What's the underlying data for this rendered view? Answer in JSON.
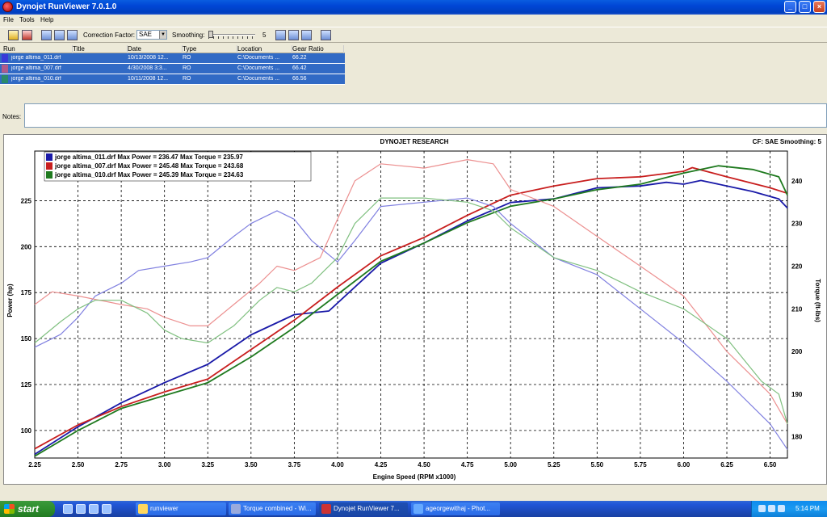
{
  "window": {
    "title": "Dynojet RunViewer 7.0.1.0",
    "min": "_",
    "max": "□",
    "close": "×"
  },
  "menu": [
    "File",
    "Tools",
    "Help"
  ],
  "toolbar": {
    "correction_label": "Correction Factor:",
    "correction_value": "SAE",
    "smoothing_label": "Smoothing:",
    "smoothing_value": "5"
  },
  "runs": {
    "headers": [
      "Run",
      "Title",
      "Date",
      "Type",
      "Location",
      "Gear Ratio"
    ],
    "rows": [
      {
        "run": "jorge altima_011.drf",
        "title": "",
        "date": "10/13/2008 12...",
        "type": "RO",
        "location": "C:\\Documents ...",
        "gear": "66.22",
        "color": "#3a3ad8"
      },
      {
        "run": "jorge altima_007.drf",
        "title": "",
        "date": "4/30/2008 3:3...",
        "type": "RO",
        "location": "C:\\Documents ...",
        "gear": "66.42",
        "color": "#d83a3a"
      },
      {
        "run": "jorge altima_010.drf",
        "title": "",
        "date": "10/11/2008 12...",
        "type": "RO",
        "location": "C:\\Documents ...",
        "gear": "66.56",
        "color": "#2a8a2a"
      }
    ]
  },
  "notes": {
    "label": "Notes:"
  },
  "chart_header": {
    "title": "DYNOJET RESEARCH",
    "settings": "CF: SAE  Smoothing: 5"
  },
  "chart_data": {
    "type": "line",
    "xlabel": "Engine Speed (RPM x1000)",
    "ylabel": "Power (hp)",
    "y2label": "Torque (ft-lbs)",
    "xlim": [
      2.25,
      6.6
    ],
    "ylim": [
      85,
      252
    ],
    "y2lim": [
      175,
      247
    ],
    "xticks": [
      "2.25",
      "2.50",
      "2.75",
      "3.00",
      "3.25",
      "3.50",
      "3.75",
      "4.00",
      "4.25",
      "4.50",
      "4.75",
      "5.00",
      "5.25",
      "5.50",
      "5.75",
      "6.00",
      "6.25",
      "6.50"
    ],
    "yticks": [
      "100",
      "125",
      "150",
      "175",
      "200",
      "225"
    ],
    "y2ticks": [
      "180",
      "190",
      "200",
      "210",
      "220",
      "230",
      "240"
    ],
    "grid": true,
    "legend_position": "top-left",
    "legend": [
      {
        "color": "#1a1aa8",
        "text": "jorge altima_011.drf Max Power = 236.47 Max Torque = 235.97"
      },
      {
        "color": "#c81e1e",
        "text": "jorge altima_007.drf Max Power = 245.48 Max Torque = 243.68"
      },
      {
        "color": "#1f7a1f",
        "text": "jorge altima_010.drf Max Power = 245.39 Max Torque = 234.63"
      }
    ],
    "series": [
      {
        "name": "jorge altima_011.drf",
        "kind": "power",
        "axis": "left",
        "color": "#1a1aa8",
        "x": [
          2.25,
          2.5,
          2.75,
          3.0,
          3.25,
          3.5,
          3.75,
          3.95,
          4.25,
          4.5,
          4.75,
          5.0,
          5.25,
          5.5,
          5.75,
          5.9,
          6.0,
          6.1,
          6.25,
          6.4,
          6.55,
          6.6
        ],
        "y": [
          87,
          102,
          115,
          126,
          136,
          152,
          163,
          165,
          191,
          202,
          214,
          224,
          226,
          232,
          233,
          235,
          234,
          236,
          233,
          230,
          226,
          221
        ]
      },
      {
        "name": "jorge altima_007.drf",
        "kind": "power",
        "axis": "left",
        "color": "#c81e1e",
        "x": [
          2.25,
          2.5,
          2.75,
          3.0,
          3.25,
          3.5,
          3.75,
          4.0,
          4.25,
          4.5,
          4.75,
          5.0,
          5.25,
          5.5,
          5.75,
          6.0,
          6.05,
          6.25,
          6.5,
          6.6
        ],
        "y": [
          90,
          103,
          113,
          121,
          128,
          144,
          160,
          178,
          195,
          205,
          217,
          228,
          233,
          237,
          238,
          241,
          243,
          238,
          232,
          229
        ]
      },
      {
        "name": "jorge altima_010.drf",
        "kind": "power",
        "axis": "left",
        "color": "#1f7a1f",
        "x": [
          2.25,
          2.5,
          2.75,
          3.0,
          3.25,
          3.5,
          3.75,
          4.0,
          4.25,
          4.5,
          4.75,
          5.0,
          5.25,
          5.5,
          5.75,
          6.0,
          6.2,
          6.4,
          6.55,
          6.6
        ],
        "y": [
          86,
          100,
          112,
          119,
          126,
          140,
          156,
          174,
          192,
          202,
          213,
          222,
          226,
          231,
          234,
          240,
          244,
          242,
          238,
          228
        ]
      },
      {
        "name": "jorge altima_011.drf",
        "kind": "torque",
        "axis": "right",
        "color": "#8080e0",
        "x": [
          2.25,
          2.4,
          2.5,
          2.6,
          2.75,
          2.85,
          3.0,
          3.15,
          3.25,
          3.4,
          3.5,
          3.6,
          3.65,
          3.75,
          3.85,
          4.0,
          4.1,
          4.25,
          4.5,
          4.75,
          4.9,
          5.0,
          5.25,
          5.5,
          5.75,
          6.0,
          6.25,
          6.5,
          6.6
        ],
        "y": [
          201,
          204,
          208,
          213,
          216,
          219,
          220,
          221,
          222,
          227,
          230,
          232,
          233,
          231,
          226,
          221,
          226,
          234,
          235,
          236,
          234,
          230,
          222,
          218,
          210,
          202,
          193,
          183,
          177
        ]
      },
      {
        "name": "jorge altima_007.drf",
        "kind": "torque",
        "axis": "right",
        "color": "#ec9090",
        "x": [
          2.25,
          2.35,
          2.5,
          2.75,
          2.9,
          3.0,
          3.15,
          3.25,
          3.4,
          3.55,
          3.65,
          3.75,
          3.9,
          4.0,
          4.1,
          4.25,
          4.5,
          4.75,
          4.9,
          5.0,
          5.25,
          5.5,
          5.75,
          6.0,
          6.25,
          6.5,
          6.6
        ],
        "y": [
          211,
          214,
          213,
          211,
          210,
          208,
          206,
          206,
          211,
          216,
          220,
          219,
          222,
          231,
          240,
          244,
          243,
          245,
          244,
          238,
          234,
          227,
          220,
          213,
          200,
          190,
          183
        ]
      },
      {
        "name": "jorge altima_010.drf",
        "kind": "torque",
        "axis": "right",
        "color": "#80c080",
        "x": [
          2.25,
          2.4,
          2.5,
          2.6,
          2.75,
          2.9,
          3.0,
          3.1,
          3.25,
          3.4,
          3.55,
          3.65,
          3.75,
          3.85,
          4.0,
          4.1,
          4.25,
          4.5,
          4.75,
          4.9,
          5.0,
          5.25,
          5.5,
          5.75,
          6.0,
          6.25,
          6.45,
          6.55,
          6.6
        ],
        "y": [
          202,
          207,
          210,
          212,
          212,
          209,
          205,
          203,
          202,
          206,
          212,
          215,
          214,
          216,
          222,
          230,
          236,
          236,
          235,
          233,
          229,
          222,
          219,
          214,
          210,
          203,
          193,
          190,
          183
        ]
      }
    ]
  },
  "taskbar": {
    "start": "start",
    "tasks": [
      "runviewer",
      "Torque combined - Wi...",
      "Dynojet RunViewer 7...",
      "ageorgewithaj - Phot..."
    ],
    "clock": "5:14 PM"
  }
}
